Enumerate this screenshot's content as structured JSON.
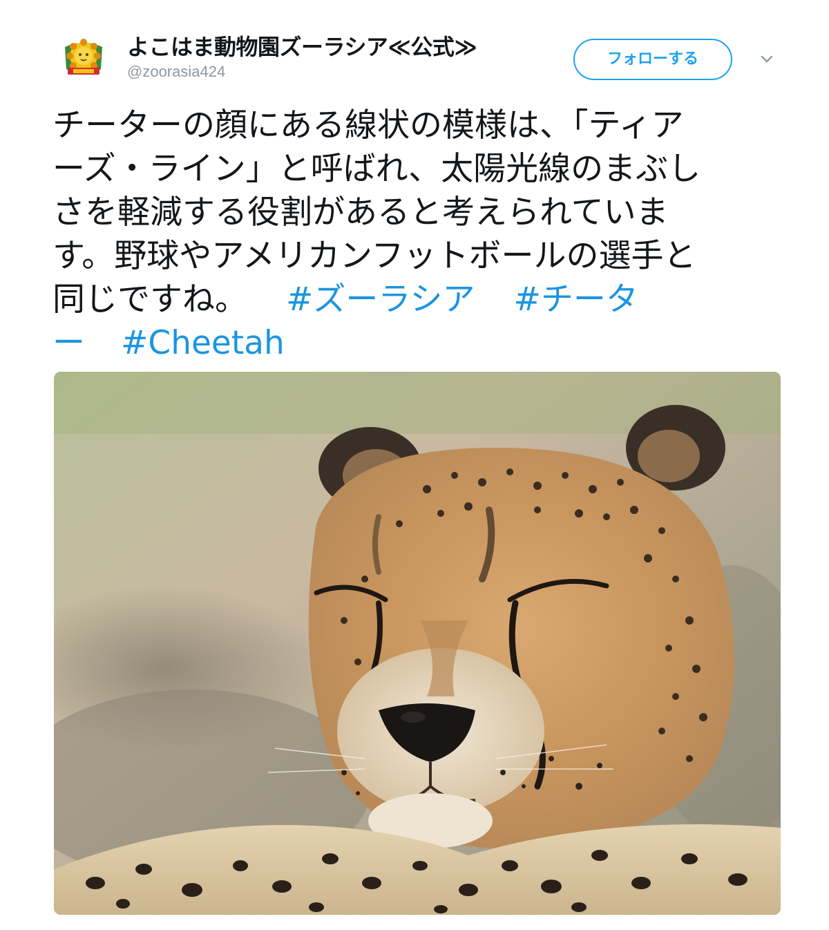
{
  "tweet": {
    "display_name": "よこはま動物園ズーラシア≪公式≫",
    "handle": "@zoorasia424",
    "follow_label": "フォローする",
    "text_line1": "チーターの顔にある線状の模様は、「ティア",
    "text_line2": "ーズ・ライン」と呼ばれ、太陽光線のまぶし",
    "text_line3": "さを軽減する役割があると考えられていま",
    "text_line4": "す。野球やアメリカンフットボールの選手と",
    "text_line5_plain": "同じですね。",
    "hashtag1": "#ズーラシア",
    "hashtag2_part1": "#チータ",
    "hashtag2_part2": "ー",
    "hashtag3": "#Cheetah",
    "icons": {
      "avatar": "zoorasia-lion-logo",
      "more": "chevron-down-icon"
    },
    "colors": {
      "accent": "#1da1f2",
      "hashtag": "#1b95e0",
      "handle": "#8b98a5",
      "text": "#14171a"
    }
  }
}
